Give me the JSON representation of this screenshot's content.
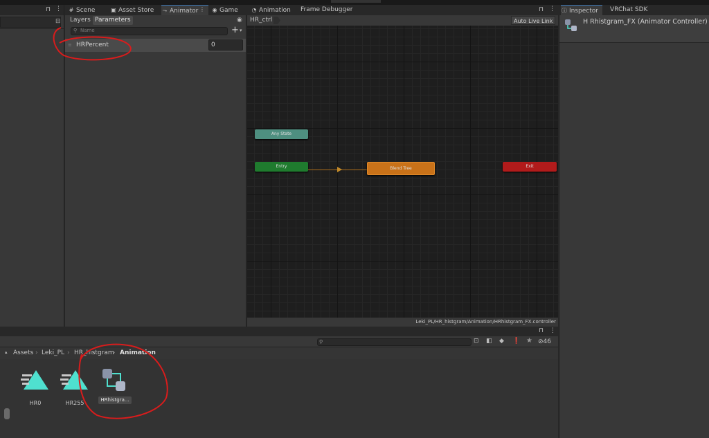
{
  "tabs": [
    {
      "label": "Scene",
      "icon": "grid-icon"
    },
    {
      "label": "Asset Store",
      "icon": "store-icon"
    },
    {
      "label": "Animator",
      "icon": "animator-icon",
      "active": true
    },
    {
      "label": "Game",
      "icon": "gamepad-icon"
    },
    {
      "label": "Animation",
      "icon": "clock-icon"
    },
    {
      "label": "Frame Debugger",
      "icon": ""
    }
  ],
  "inspector_tabs": [
    {
      "label": "Inspector",
      "icon": "info-icon",
      "active": true
    },
    {
      "label": "VRChat SDK"
    }
  ],
  "animator": {
    "left_tabs": [
      "Layers",
      "Parameters"
    ],
    "search_placeholder": "Name",
    "add_symbol": "+",
    "parameter": {
      "name": "HRPercent",
      "value": "0"
    },
    "graph_title": "HR_ctrl",
    "auto_live_link": "Auto Live Link",
    "status_path": "Leki_PL/HR_histgram/Animation/HRhistgram_FX.controller",
    "nodes": {
      "any_state": "Any State",
      "entry": "Entry",
      "blend_tree": "Blend Tree",
      "exit": "Exit"
    }
  },
  "inspector": {
    "title": "H Rhistgram_FX (Animator Controller)"
  },
  "project": {
    "breadcrumb": [
      "Assets",
      "Leki_PL",
      "HR_histgram",
      "Animation"
    ],
    "hidden_count": "46",
    "assets": [
      {
        "name": "HR0",
        "type": "animation-clip-icon"
      },
      {
        "name": "HR255",
        "type": "animation-clip-icon"
      },
      {
        "name": "HRhistgra...",
        "type": "animator-controller-icon",
        "selected": true
      }
    ]
  },
  "colors": {
    "accent": "#3a79bb",
    "any_state": "#4e8f80",
    "entry": "#1f7b2e",
    "blend_tree": "#c97219",
    "exit": "#b11b1b",
    "annotation": "#d91c1c",
    "clip_icon": "#4fe0cf"
  }
}
